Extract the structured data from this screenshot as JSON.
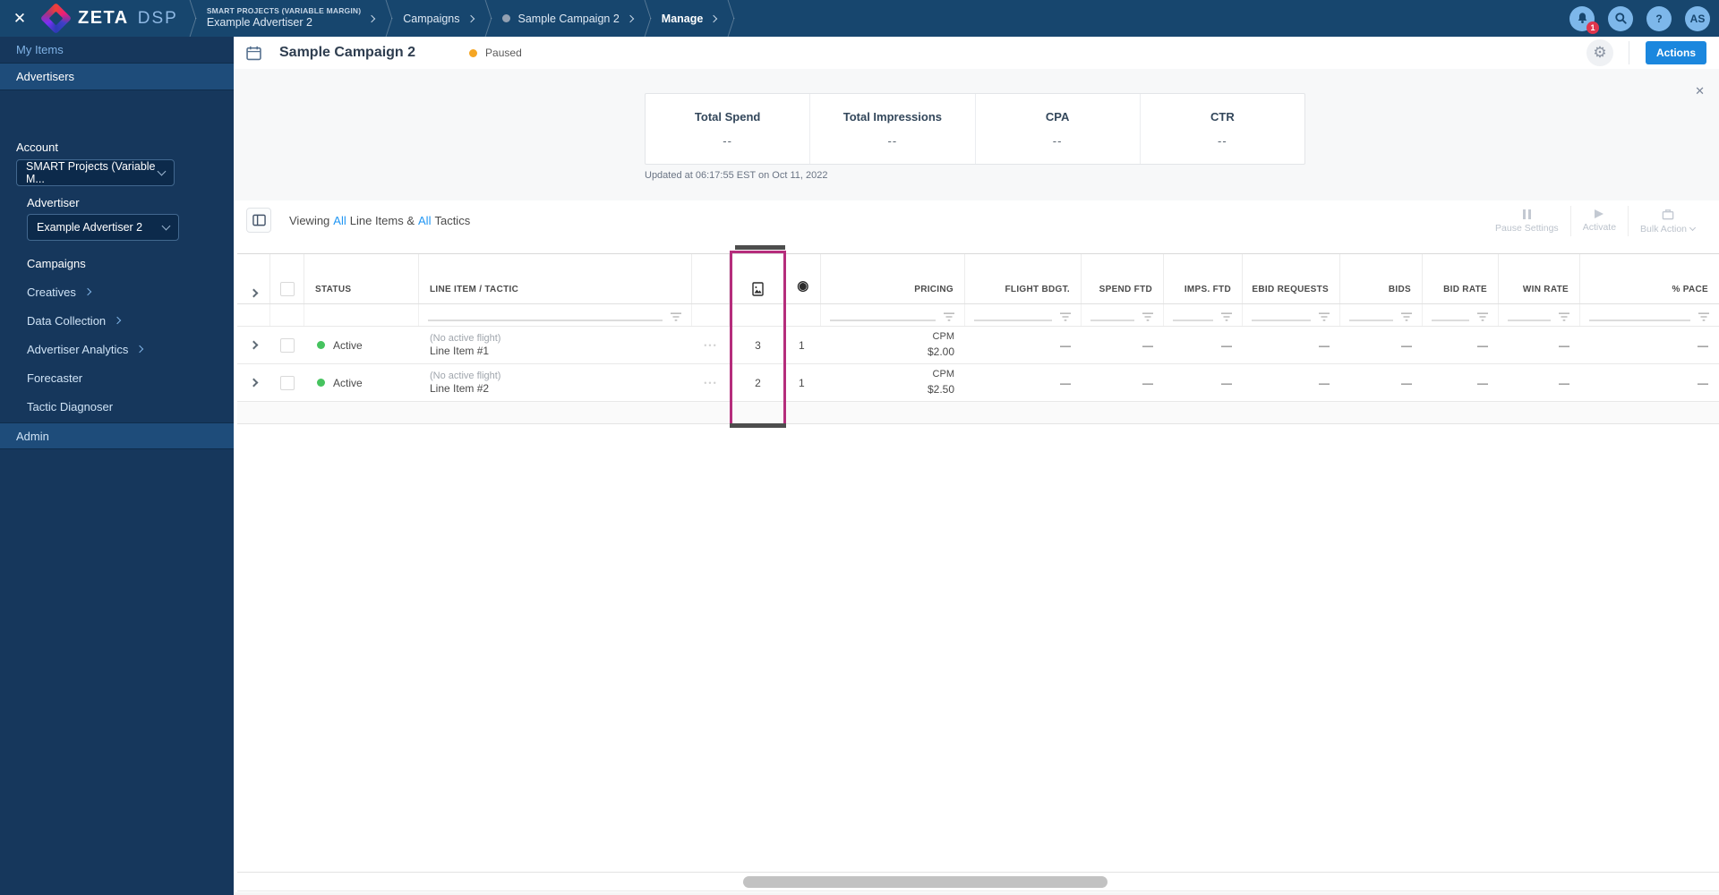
{
  "topnav": {
    "brand": "ZETA",
    "product": "DSP",
    "breadcrumbs": {
      "account_eyebrow": "SMART PROJECTS (VARIABLE MARGIN)",
      "account": "Example Advertiser 2",
      "campaigns": "Campaigns",
      "campaign": "Sample Campaign 2",
      "manage": "Manage"
    },
    "notification_count": "1",
    "help_glyph": "?",
    "avatar_initials": "AS"
  },
  "sidebar": {
    "my_items": "My Items",
    "advertisers": "Advertisers",
    "account_label": "Account",
    "account_value": "SMART Projects (Variable M...",
    "advertiser_label": "Advertiser",
    "advertiser_value": "Example Advertiser 2",
    "nav": [
      {
        "label": "Campaigns",
        "active": true,
        "arrow": false
      },
      {
        "label": "Creatives",
        "active": false,
        "arrow": true
      },
      {
        "label": "Data Collection",
        "active": false,
        "arrow": true
      },
      {
        "label": "Advertiser Analytics",
        "active": false,
        "arrow": true
      },
      {
        "label": "Forecaster",
        "active": false,
        "arrow": false
      },
      {
        "label": "Tactic Diagnoser",
        "active": false,
        "arrow": false
      }
    ],
    "admin": "Admin"
  },
  "header": {
    "title": "Sample Campaign 2",
    "status": "Paused",
    "actions_button": "Actions"
  },
  "stats": {
    "items": [
      {
        "label": "Total Spend",
        "value": "--"
      },
      {
        "label": "Total Impressions",
        "value": "--"
      },
      {
        "label": "CPA",
        "value": "--"
      },
      {
        "label": "CTR",
        "value": "--"
      }
    ],
    "updated": "Updated at 06:17:55 EST on Oct 11, 2022"
  },
  "toolbar": {
    "viewing": [
      "Viewing",
      "All",
      "Line Items &",
      "All",
      "Tactics"
    ],
    "pause_settings": "Pause Settings",
    "activate": "Activate",
    "bulk_action": "Bulk Action"
  },
  "table": {
    "headers": {
      "status": "STATUS",
      "line_item": "LINE ITEM / TACTIC",
      "pricing": "PRICING",
      "flight_budget": "FLIGHT BDGT.",
      "spend_ftd": "SPEND FTD",
      "imps_ftd": "IMPS. FTD",
      "ebid_requests": "EBID REQUESTS",
      "bids": "BIDS",
      "bid_rate": "BID RATE",
      "win_rate": "WIN RATE",
      "pace": "% PACE"
    },
    "rows": [
      {
        "status": "Active",
        "flight_note": "(No active flight)",
        "name": "Line Item #1",
        "creatives": "3",
        "tactics": "1",
        "pricing_model": "CPM",
        "pricing_rate": "$2.00",
        "flight_budget": "—",
        "spend_ftd": "—",
        "imps_ftd": "—",
        "ebid_requests": "—",
        "bids": "—",
        "bid_rate": "—",
        "win_rate": "—",
        "pace": "—"
      },
      {
        "status": "Active",
        "flight_note": "(No active flight)",
        "name": "Line Item #2",
        "creatives": "2",
        "tactics": "1",
        "pricing_model": "CPM",
        "pricing_rate": "$2.50",
        "flight_budget": "—",
        "spend_ftd": "—",
        "imps_ftd": "—",
        "ebid_requests": "—",
        "bids": "—",
        "bid_rate": "—",
        "win_rate": "—",
        "pace": "—"
      }
    ]
  },
  "icons": {
    "close": "✕",
    "gear": "⚙",
    "target": "◉",
    "ellipsis": "•••"
  },
  "colors": {
    "navbar_blue": "#17466e",
    "sidebar_blue": "#16375c",
    "accent_blue": "#1b87de",
    "link_blue": "#2196f3",
    "magenta_highlight": "#b52d7c",
    "status_green": "#46c35f",
    "status_orange": "#f5a623",
    "badge_red": "#e0354d"
  }
}
